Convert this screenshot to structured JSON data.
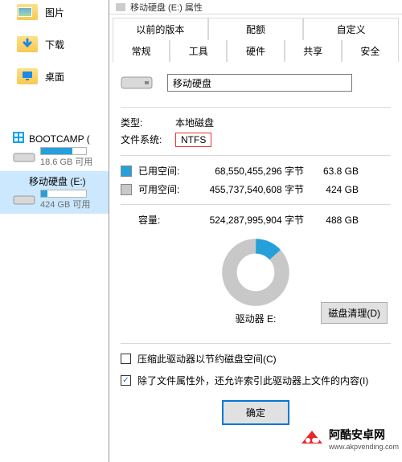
{
  "sidebar": {
    "nav": [
      {
        "label": "图片",
        "icon": "pictures-folder-icon"
      },
      {
        "label": "下载",
        "icon": "downloads-folder-icon"
      },
      {
        "label": "桌面",
        "icon": "desktop-folder-icon"
      }
    ],
    "drives": [
      {
        "name": "BOOTCAMP (",
        "sub": "18.6 GB 可用",
        "fill_pct": 70,
        "selected": false,
        "badge": "windows"
      },
      {
        "name": "移动硬盘 (E:)",
        "sub": "424 GB 可用",
        "fill_pct": 14,
        "selected": true,
        "badge": "none"
      }
    ]
  },
  "dialog": {
    "title": "移动硬盘 (E:) 属性",
    "tabs_row1": [
      "以前的版本",
      "配额",
      "自定义"
    ],
    "tabs_row2": [
      "常规",
      "工具",
      "硬件",
      "共享",
      "安全"
    ],
    "active_tab": "常规",
    "drive_name": "移动硬盘",
    "rows": {
      "type_label": "类型:",
      "type_value": "本地磁盘",
      "fs_label": "文件系统:",
      "fs_value": "NTFS"
    },
    "space": {
      "used_label": "已用空间:",
      "used_bytes": "68,550,455,296 字节",
      "used_gb": "63.8 GB",
      "free_label": "可用空间:",
      "free_bytes": "455,737,540,608 字节",
      "free_gb": "424 GB",
      "capacity_label": "容量:",
      "capacity_bytes": "524,287,995,904 字节",
      "capacity_gb": "488 GB"
    },
    "drive_letter": "驱动器 E:",
    "cleanup_btn": "磁盘清理(D)",
    "check_compress": "压缩此驱动器以节约磁盘空间(C)",
    "check_index": "除了文件属性外，还允许索引此驱动器上文件的内容(I)",
    "check_compress_checked": false,
    "check_index_checked": true,
    "buttons": {
      "ok": "确定"
    }
  },
  "chart_data": {
    "type": "pie",
    "title": "",
    "series": [
      {
        "name": "已用空间",
        "value": 68550455296,
        "color": "#26a0da"
      },
      {
        "name": "可用空间",
        "value": 455737540608,
        "color": "#c8c8c8"
      }
    ],
    "used_pct": 13.1
  },
  "watermark": {
    "text": "阿酷安卓网",
    "subtext": "www.akpvending.com"
  }
}
